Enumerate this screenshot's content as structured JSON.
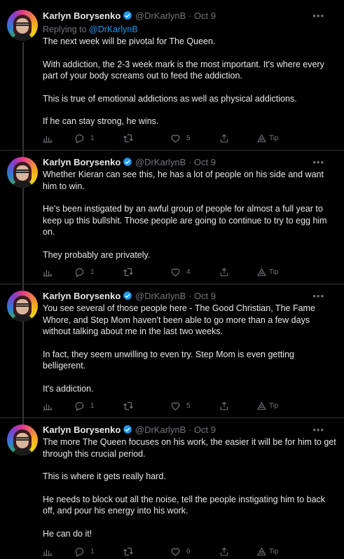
{
  "tweets": [
    {
      "name": "Karlyn Borysenko",
      "handle": "@DrKarlynB",
      "dot": "·",
      "date": "Oct 9",
      "replying_prefix": "Replying to",
      "replying_handle": "@DrKarlynB",
      "paragraphs": [
        "The next week will be pivotal for The Queen.",
        "With addiction, the 2-3 week mark is the most important. It's where every part of your body screams out to feed the addiction.",
        "This is true of emotional addictions as well as physical addictions.",
        "If he can stay strong, he wins."
      ],
      "replies": "1",
      "retweets": "",
      "likes": "5",
      "tip": "Tip"
    },
    {
      "name": "Karlyn Borysenko",
      "handle": "@DrKarlynB",
      "dot": "·",
      "date": "Oct 9",
      "paragraphs": [
        "Whether Kieran can see this, he has a lot of people on his side and want him to win.",
        "He's been instigated by an awful group of people for almost a full year to keep up this bullshit. Those people are going to continue to try to egg him on.",
        "They probably are privately."
      ],
      "replies": "1",
      "retweets": "",
      "likes": "4",
      "tip": "Tip"
    },
    {
      "name": "Karlyn Borysenko",
      "handle": "@DrKarlynB",
      "dot": "·",
      "date": "Oct 9",
      "paragraphs": [
        "You see several of those people here - The Good Christian, The Fame Whore, and Step Mom haven't been able to go more than a few days without talking about me in the last two weeks.",
        "In fact, they seem unwilling to even try. Step Mom is even getting belligerent.",
        "It's addiction."
      ],
      "replies": "1",
      "retweets": "",
      "likes": "5",
      "tip": "Tip"
    },
    {
      "name": "Karlyn Borysenko",
      "handle": "@DrKarlynB",
      "dot": "·",
      "date": "Oct 9",
      "paragraphs": [
        "The more The Queen focuses on his work, the easier it will be for him to get through this crucial period.",
        "This is where it gets really hard.",
        "He needs to block out all the noise, tell the people instigating him to back off, and pour his energy into his work.",
        "He can do it!"
      ],
      "replies": "1",
      "retweets": "",
      "likes": "6",
      "tip": "Tip"
    }
  ],
  "icons": {
    "analytics": "bar-chart-icon",
    "reply": "speech-bubble-icon",
    "retweet": "retweet-arrows-icon",
    "like": "heart-icon",
    "share": "upload-icon",
    "tip": "tip-icon",
    "verified": "verified-badge-icon",
    "more": "ellipsis-icon"
  },
  "colors": {
    "background": "#000000",
    "text": "#e7e9ea",
    "muted": "#71767b",
    "link": "#1d9bf0",
    "verified": "#1d9bf0"
  }
}
